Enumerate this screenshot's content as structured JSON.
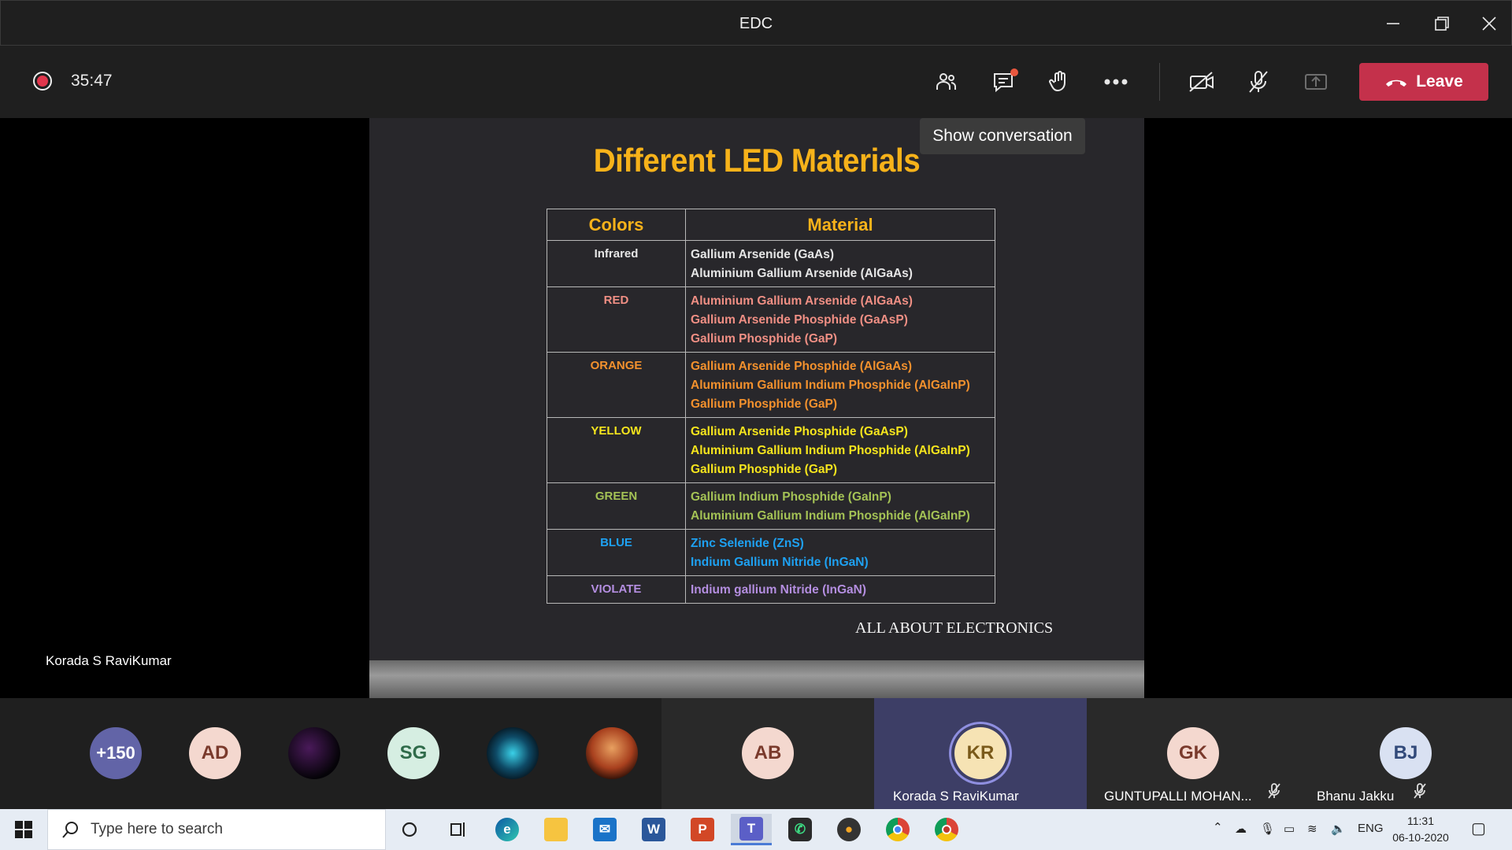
{
  "window": {
    "title": "EDC"
  },
  "toolbar": {
    "timer": "35:47",
    "leave_label": "Leave",
    "tooltip": "Show conversation"
  },
  "slide": {
    "title": "Different LED Materials",
    "table": {
      "headers": [
        "Colors",
        "Material"
      ],
      "rows": [
        {
          "color": "Infrared",
          "hex": "#e6e6e6",
          "materials": [
            "Gallium Arsenide (GaAs)",
            "Aluminium Gallium Arsenide (AlGaAs)"
          ]
        },
        {
          "color": "RED",
          "hex": "#f08f84",
          "materials": [
            "Aluminium Gallium Arsenide (AlGaAs)",
            "Gallium Arsenide Phosphide (GaAsP)",
            "Gallium Phosphide (GaP)"
          ]
        },
        {
          "color": "ORANGE",
          "hex": "#f3912d",
          "materials": [
            "Gallium Arsenide Phosphide (AlGaAs)",
            "Aluminium Gallium Indium Phosphide (AlGaInP)",
            "Gallium Phosphide (GaP)"
          ]
        },
        {
          "color": "YELLOW",
          "hex": "#f6e51d",
          "materials": [
            "Gallium Arsenide Phosphide (GaAsP)",
            "Aluminium Gallium Indium Phosphide (AlGaInP)",
            "Gallium Phosphide (GaP)"
          ]
        },
        {
          "color": "GREEN",
          "hex": "#a4c255",
          "materials": [
            "Gallium Indium Phosphide (GaInP)",
            "Aluminium Gallium Indium Phosphide (AlGaInP)"
          ]
        },
        {
          "color": "BLUE",
          "hex": "#1ea1f2",
          "materials": [
            "Zinc Selenide (ZnS)",
            "Indium Gallium Nitride (InGaN)"
          ]
        },
        {
          "color": "VIOLATE",
          "hex": "#b48ee0",
          "materials": [
            "Indium gallium Nitride (InGaN)"
          ]
        }
      ]
    },
    "footer": "ALL ABOUT ELECTRONICS",
    "presenter": "Korada S RaviKumar"
  },
  "participants": {
    "overflow": "+150",
    "avatars": [
      {
        "initials": "AD",
        "bg": "#f4d8cf",
        "fg": "#7a3a2c"
      },
      {
        "initials": "",
        "bg": "#1a1020",
        "fg": "#ffffff"
      },
      {
        "initials": "SG",
        "bg": "#d6eee2",
        "fg": "#2f6b4a"
      },
      {
        "initials": "",
        "bg": "#0e2a3a",
        "fg": "#ffffff"
      },
      {
        "initials": "",
        "bg": "#6b2b1a",
        "fg": "#ffffff"
      }
    ],
    "tiles": [
      {
        "initials": "AB",
        "name": ""
      },
      {
        "initials": "KR",
        "name": "Korada S RaviKumar"
      },
      {
        "initials": "GK",
        "name": "GUNTUPALLI MOHAN..."
      },
      {
        "initials": "BJ",
        "name": "Bhanu Jakku"
      }
    ]
  },
  "taskbar": {
    "search_placeholder": "Type here to search",
    "language": "ENG",
    "time": "11:31",
    "date": "06-10-2020"
  }
}
